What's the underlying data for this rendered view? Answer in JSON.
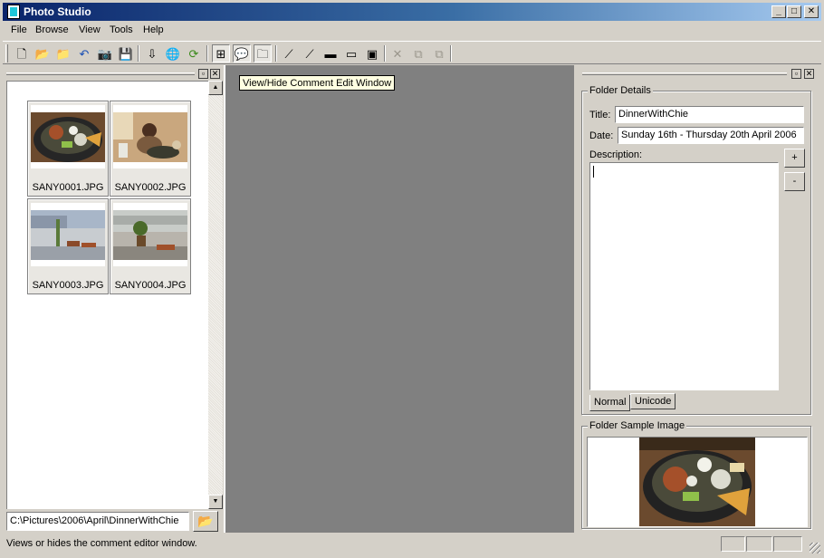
{
  "window": {
    "title": "Photo Studio"
  },
  "menu": [
    "File",
    "Browse",
    "View",
    "Tools",
    "Help"
  ],
  "toolbar": {
    "buttons": [
      {
        "icon": "new-document-icon",
        "glyph": "🗋"
      },
      {
        "icon": "open-folder-icon",
        "glyph": "📂"
      },
      {
        "icon": "browse-folder-icon",
        "glyph": "📁"
      },
      {
        "icon": "undo-icon",
        "glyph": "↶"
      },
      {
        "icon": "camera-icon",
        "glyph": "📷"
      },
      {
        "icon": "save-icon",
        "glyph": "💾"
      },
      {
        "icon": "download-icon",
        "glyph": "⇩"
      },
      {
        "icon": "globe-icon",
        "glyph": "🌐"
      },
      {
        "icon": "refresh-folders-icon",
        "glyph": "⟳"
      },
      {
        "icon": "thumbnail-view-icon",
        "glyph": "⊞"
      },
      {
        "icon": "comment-window-icon",
        "glyph": "💬"
      },
      {
        "icon": "folder-comment-icon",
        "glyph": "🗀"
      },
      {
        "icon": "magic-wand-icon",
        "glyph": "⟋"
      },
      {
        "icon": "magic-wand-alt-icon",
        "glyph": "⟋"
      },
      {
        "icon": "image-frame-icon",
        "glyph": "▬"
      },
      {
        "icon": "slideshow-icon",
        "glyph": "▭"
      },
      {
        "icon": "presentation-icon",
        "glyph": "▣"
      },
      {
        "icon": "delete-icon",
        "glyph": "✕"
      },
      {
        "icon": "copy-icon",
        "glyph": "⧉"
      },
      {
        "icon": "move-icon",
        "glyph": "⧉"
      }
    ]
  },
  "thumbnails": [
    {
      "filename": "SANY0001.JPG"
    },
    {
      "filename": "SANY0002.JPG"
    },
    {
      "filename": "SANY0003.JPG"
    },
    {
      "filename": "SANY0004.JPG"
    }
  ],
  "path": {
    "value": "C:\\Pictures\\2006\\April\\DinnerWithChie"
  },
  "tooltip": "View/Hide Comment Edit Window",
  "folder_details": {
    "group_title": "Folder Details",
    "title_label": "Title:",
    "title_value": "DinnerWithChie",
    "date_label": "Date:",
    "date_value": "Sunday 16th - Thursday 20th April 2006",
    "description_label": "Description:",
    "plus_label": "+",
    "minus_label": "-",
    "tabs": [
      "Normal",
      "Unicode"
    ]
  },
  "sample_image": {
    "group_title": "Folder Sample Image"
  },
  "status": {
    "text": "Views or hides the comment editor window."
  }
}
